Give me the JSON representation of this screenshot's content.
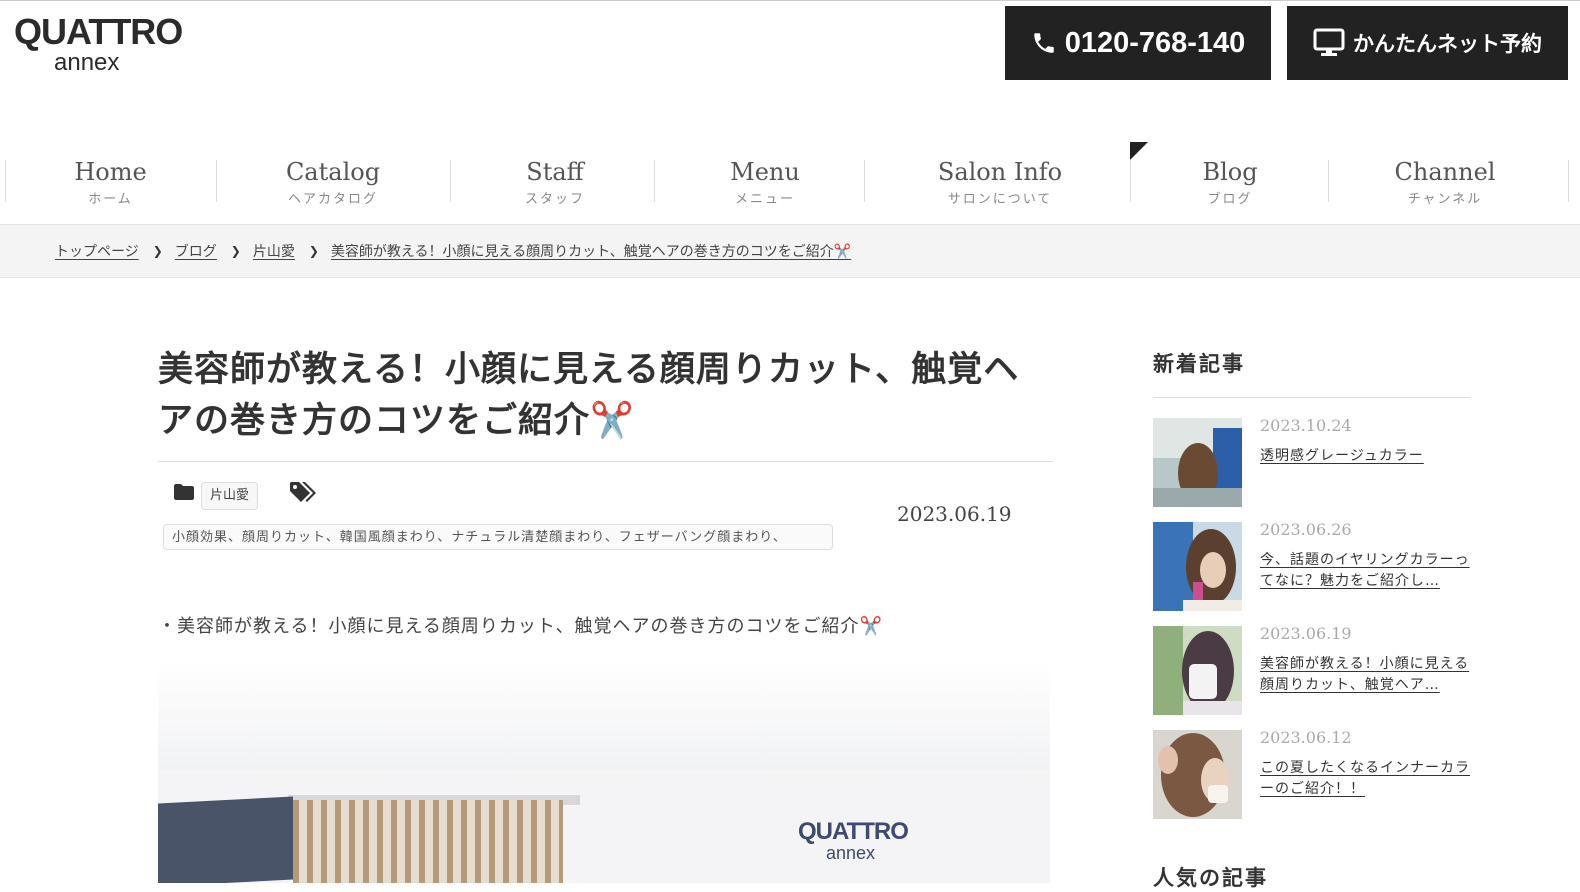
{
  "brand": {
    "logo_line1": "QUATTRO",
    "logo_line2": "annex"
  },
  "header": {
    "phone_label": "0120-768-140",
    "reserve_label": "かんたんネット予約",
    "icons": {
      "phone": "phone-icon",
      "reserve": "monitor-icon"
    }
  },
  "nav": {
    "items": [
      {
        "en": "Home",
        "ja": "ホーム"
      },
      {
        "en": "Catalog",
        "ja": "ヘアカタログ"
      },
      {
        "en": "Staff",
        "ja": "スタッフ"
      },
      {
        "en": "Menu",
        "ja": "メニュー"
      },
      {
        "en": "Salon Info",
        "ja": "サロンについて"
      },
      {
        "en": "Blog",
        "ja": "ブログ"
      },
      {
        "en": "Channel",
        "ja": "チャンネル"
      }
    ]
  },
  "breadcrumb": [
    "トップページ",
    "ブログ",
    "片山愛",
    "美容師が教える！小顔に見える顔周りカット、触覚ヘアの巻き方のコツをご紹介✂️"
  ],
  "article": {
    "title": "美容師が教える！小顔に見える顔周りカット、触覚ヘアの巻き方のコツをご紹介✂️",
    "category": "片山愛",
    "tags": "小顔効果、顔周りカット、韓国風顔まわり、ナチュラル清楚顔まわり、フェザーバング顔まわり、",
    "date": "2023.06.19",
    "lead": "・美容師が教える！小顔に見える顔周りカット、触覚ヘアの巻き方のコツをご紹介✂️",
    "hero_sign_line1": "QUATTRO",
    "hero_sign_line2": "annex"
  },
  "sidebar": {
    "new_heading": "新着記事",
    "posts": [
      {
        "date": "2023.10.24",
        "title": "透明感グレージュカラー"
      },
      {
        "date": "2023.06.26",
        "title": "今、話題のイヤリングカラーってなに？魅力をご紹介し…"
      },
      {
        "date": "2023.06.19",
        "title": "美容師が教える！小顔に見える顔周りカット、触覚ヘア…"
      },
      {
        "date": "2023.06.12",
        "title": "この夏したくなるインナーカラーのご紹介！！"
      }
    ],
    "popular_heading": "人気の記事"
  },
  "colors": {
    "dark_button": "#222222",
    "breadcrumb_bg": "#f4f4f4",
    "text": "#333333"
  }
}
